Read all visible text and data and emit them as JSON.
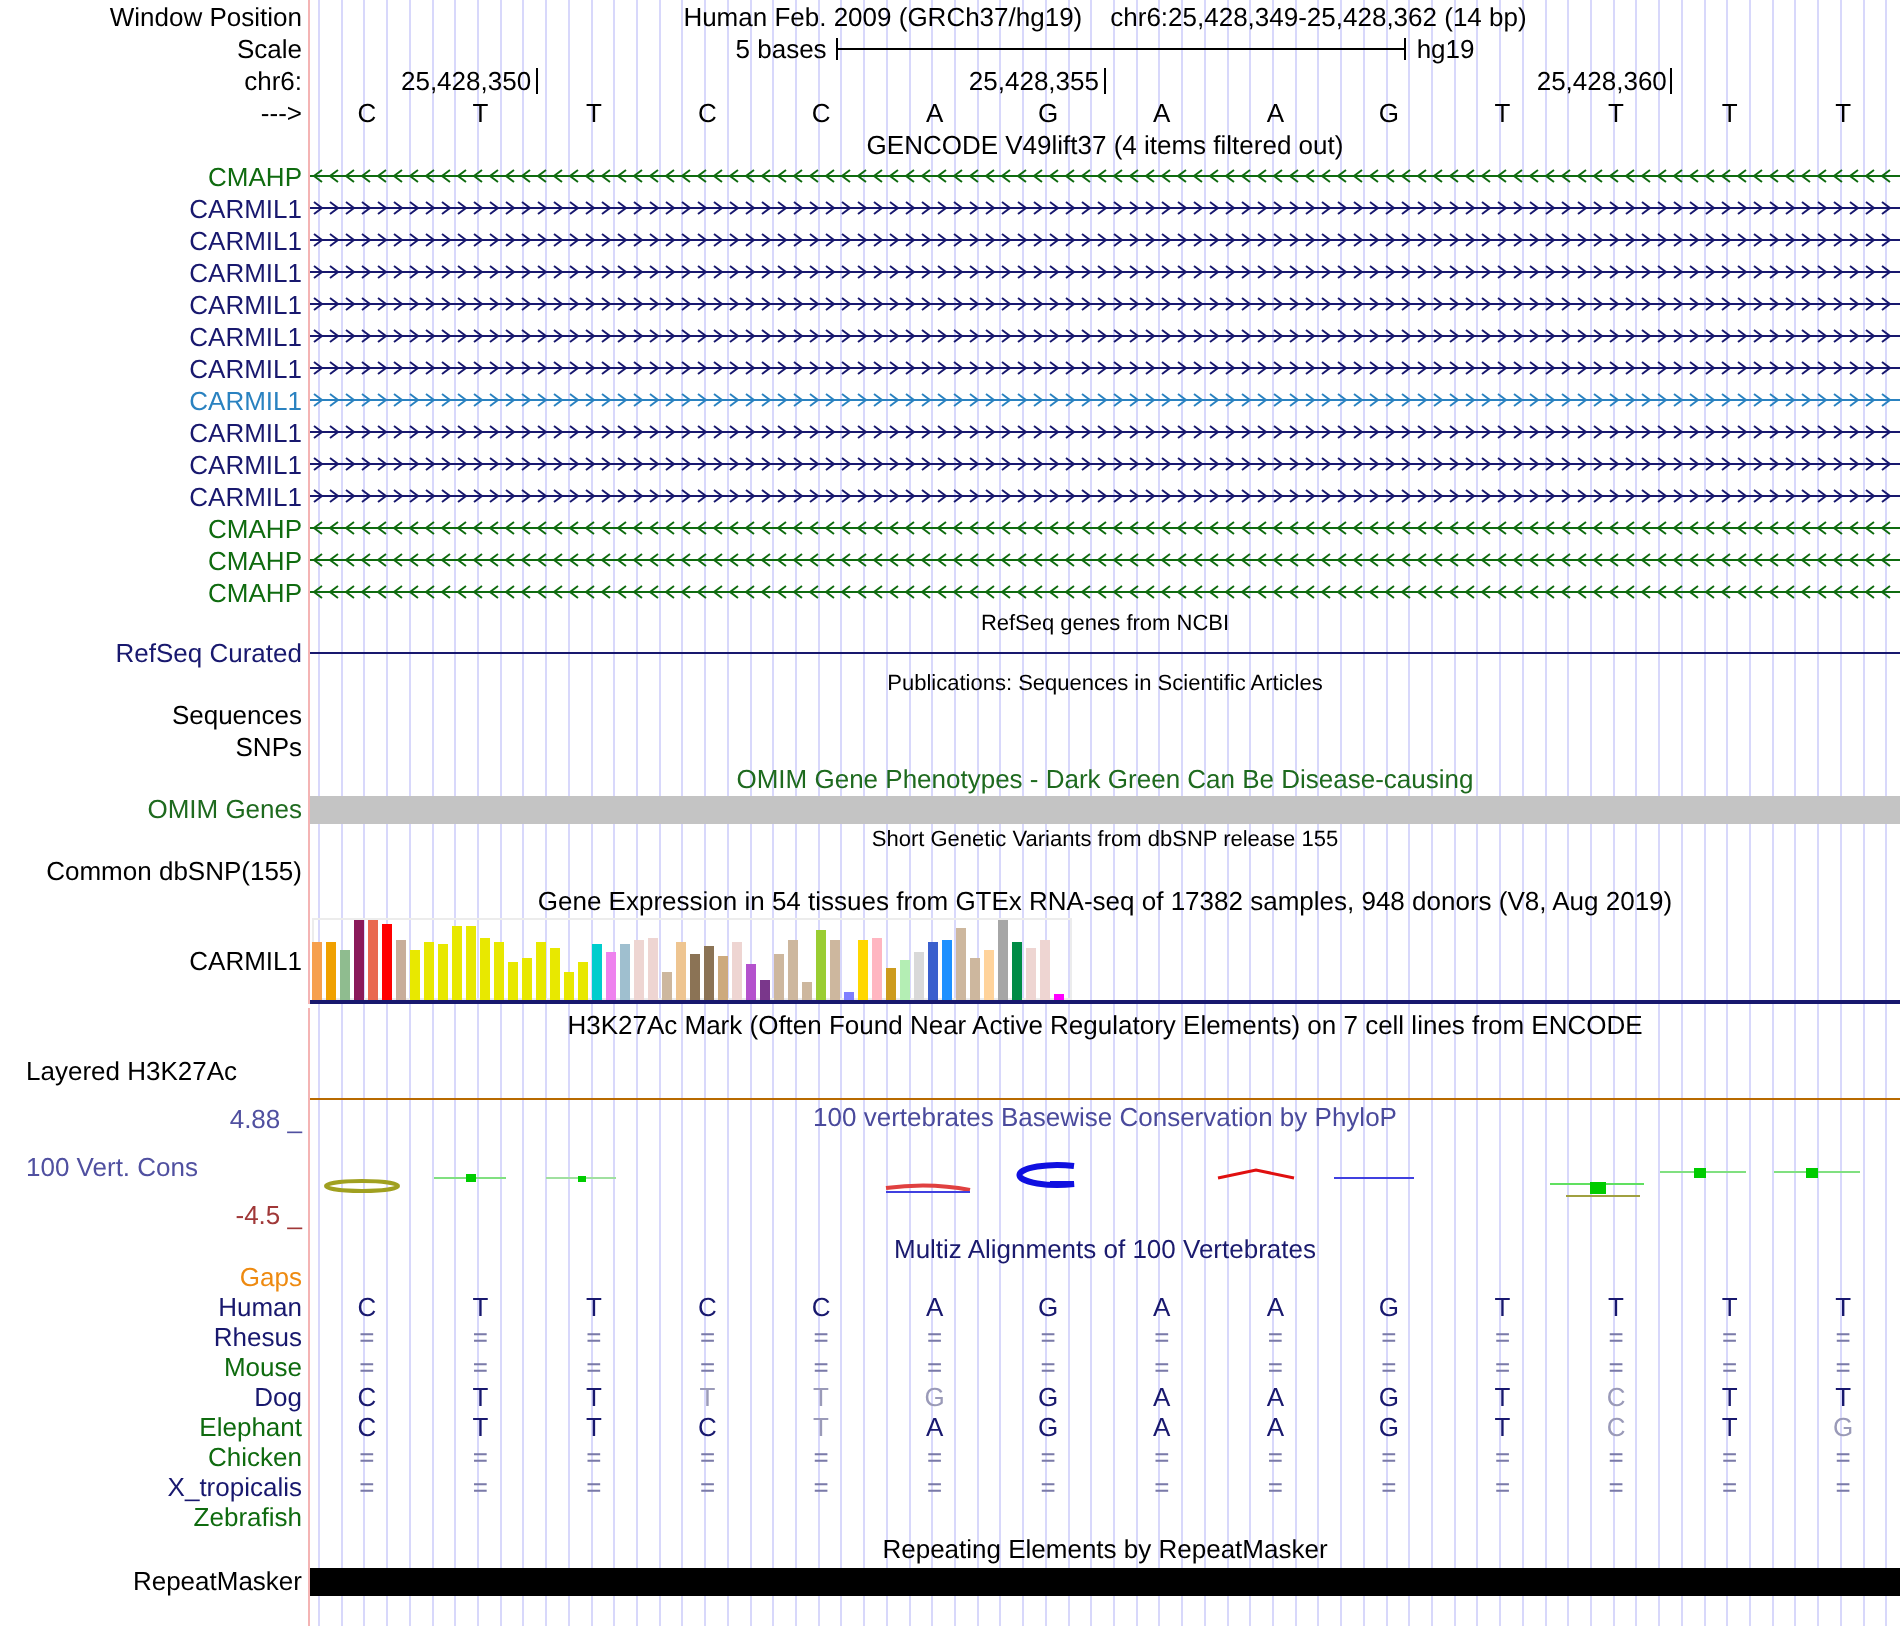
{
  "ruler": {
    "window_label": "Window Position",
    "assembly": "Human Feb. 2009 (GRCh37/hg19)",
    "position": "chr6:25,428,349-25,428,362 (14 bp)",
    "scale_label": "Scale",
    "scale_text": "5 bases",
    "scale_db": "hg19",
    "chrom_label": "chr6:",
    "ticks": [
      "25,428,350",
      "25,428,355",
      "25,428,360"
    ],
    "strand_label": "--->",
    "bases": [
      "C",
      "T",
      "T",
      "C",
      "C",
      "A",
      "G",
      "A",
      "A",
      "G",
      "T",
      "T",
      "T",
      "T"
    ]
  },
  "tracks": [
    {
      "kind": "genes",
      "title": "GENCODE V49lift37 (4 items filtered out)",
      "items": [
        {
          "name": "CMAHP",
          "reverse": true,
          "color": "#0f6b0f"
        },
        {
          "name": "CARMIL1",
          "reverse": false,
          "color": "#18186e"
        },
        {
          "name": "CARMIL1",
          "reverse": false,
          "color": "#18186e"
        },
        {
          "name": "CARMIL1",
          "reverse": false,
          "color": "#18186e"
        },
        {
          "name": "CARMIL1",
          "reverse": false,
          "color": "#18186e"
        },
        {
          "name": "CARMIL1",
          "reverse": false,
          "color": "#18186e"
        },
        {
          "name": "CARMIL1",
          "reverse": false,
          "color": "#18186e"
        },
        {
          "name": "CARMIL1",
          "reverse": false,
          "color": "#2a82c0"
        },
        {
          "name": "CARMIL1",
          "reverse": false,
          "color": "#18186e"
        },
        {
          "name": "CARMIL1",
          "reverse": false,
          "color": "#18186e"
        },
        {
          "name": "CARMIL1",
          "reverse": false,
          "color": "#18186e"
        },
        {
          "name": "CMAHP",
          "reverse": true,
          "color": "#0f6b0f"
        },
        {
          "name": "CMAHP",
          "reverse": true,
          "color": "#0f6b0f"
        },
        {
          "name": "CMAHP",
          "reverse": true,
          "color": "#0f6b0f"
        }
      ]
    },
    {
      "kind": "refseq",
      "title": "RefSeq genes from NCBI",
      "labels": [
        "RefSeq Curated"
      ]
    },
    {
      "kind": "pubs",
      "title": "Publications: Sequences in Scientific Articles",
      "labels": [
        "Sequences",
        "SNPs"
      ]
    },
    {
      "kind": "omim",
      "title": "OMIM Gene Phenotypes - Dark Green Can Be Disease-causing",
      "labels": [
        "OMIM Genes"
      ]
    },
    {
      "kind": "dbsnp",
      "title": "Short Genetic Variants from dbSNP release 155",
      "labels": [
        "Common dbSNP(155)"
      ]
    },
    {
      "kind": "gtex",
      "title": "Gene Expression in 54 tissues from GTEx RNA-seq of 17382 samples, 948 donors (V8, Aug 2019)",
      "labels": [
        "CARMIL1"
      ]
    },
    {
      "kind": "h3k27ac",
      "title": "H3K27Ac Mark (Often Found Near Active Regulatory Elements) on 7 cell lines from ENCODE",
      "labels": [
        "Layered H3K27Ac"
      ]
    },
    {
      "kind": "phylop",
      "title": "100 vertebrates Basewise Conservation by PhyloP",
      "labels": [
        "4.88 _",
        "100 Vert. Cons",
        "-4.5 _"
      ]
    },
    {
      "kind": "multiz",
      "title": "Multiz Alignments of 100 Vertebrates",
      "species": [
        {
          "name": "Gaps",
          "kind": "empty",
          "color": "#ee8a10"
        },
        {
          "name": "Human",
          "kind": "bases",
          "color": "#18186e",
          "bases": [
            "C",
            "T",
            "T",
            "C",
            "C",
            "A",
            "G",
            "A",
            "A",
            "G",
            "T",
            "T",
            "T",
            "T"
          ],
          "faded": [
            false,
            false,
            false,
            false,
            false,
            false,
            false,
            false,
            false,
            false,
            false,
            false,
            false,
            false
          ]
        },
        {
          "name": "Rhesus",
          "kind": "match",
          "color": "#18186e",
          "bases": [
            "=",
            "=",
            "=",
            "=",
            "=",
            "=",
            "=",
            "=",
            "=",
            "=",
            "=",
            "=",
            "=",
            "="
          ]
        },
        {
          "name": "Mouse",
          "kind": "match",
          "color": "#0f6b0f",
          "bases": [
            "=",
            "=",
            "=",
            "=",
            "=",
            "=",
            "=",
            "=",
            "=",
            "=",
            "=",
            "=",
            "=",
            "="
          ]
        },
        {
          "name": "Dog",
          "kind": "bases",
          "color": "#18186e",
          "bases": [
            "C",
            "T",
            "T",
            "T",
            "T",
            "G",
            "G",
            "A",
            "A",
            "G",
            "T",
            "C",
            "T",
            "T"
          ],
          "faded": [
            false,
            false,
            false,
            true,
            true,
            true,
            false,
            false,
            false,
            false,
            false,
            true,
            false,
            false
          ]
        },
        {
          "name": "Elephant",
          "kind": "bases",
          "color": "#0f6b0f",
          "bases": [
            "C",
            "T",
            "T",
            "C",
            "T",
            "A",
            "G",
            "A",
            "A",
            "G",
            "T",
            "C",
            "T",
            "G"
          ],
          "faded": [
            false,
            false,
            false,
            false,
            true,
            false,
            false,
            false,
            false,
            false,
            false,
            true,
            false,
            true
          ]
        },
        {
          "name": "Chicken",
          "kind": "match",
          "color": "#0f6b0f",
          "bases": [
            "=",
            "=",
            "=",
            "=",
            "=",
            "=",
            "=",
            "=",
            "=",
            "=",
            "=",
            "=",
            "=",
            "="
          ]
        },
        {
          "name": "X_tropicalis",
          "kind": "match",
          "color": "#18186e",
          "bases": [
            "=",
            "=",
            "=",
            "=",
            "=",
            "=",
            "=",
            "=",
            "=",
            "=",
            "=",
            "=",
            "=",
            "="
          ]
        },
        {
          "name": "Zebrafish",
          "kind": "empty",
          "color": "#0f6b0f"
        }
      ]
    },
    {
      "kind": "rmsk",
      "title": "Repeating Elements by RepeatMasker",
      "labels": [
        "RepeatMasker"
      ]
    }
  ]
}
